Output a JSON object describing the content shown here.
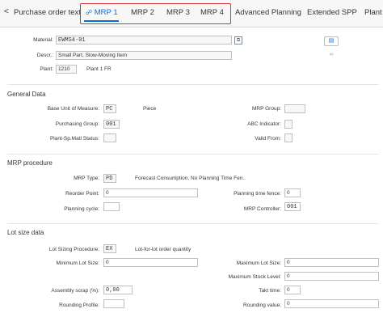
{
  "tabs": {
    "back_glyph": "<",
    "items": [
      {
        "label": "Purchase order text"
      },
      {
        "label": "MRP 1"
      },
      {
        "label": "MRP 2"
      },
      {
        "label": "MRP 3"
      },
      {
        "label": "MRP 4"
      },
      {
        "label": "Advanced Planning"
      },
      {
        "label": "Extended SPP"
      },
      {
        "label": "Plant"
      }
    ],
    "active_index": 1,
    "highlight_color": "#d9333a",
    "accent_color": "#0a6ed1"
  },
  "header": {
    "material_label": "Material:",
    "material_value": "EWMS4-01",
    "descr_label": "Descr.:",
    "descr_value": "Small Part, Slow-Moving Item",
    "plant_label": "Plant:",
    "plant_value": "1210",
    "plant_text": "Plant 1 FR"
  },
  "general": {
    "title": "General Data",
    "base_uom_label": "Base Unit of Measure:",
    "base_uom_value": "PC",
    "base_uom_text": "Piece",
    "purch_group_label": "Purchasing Group:",
    "purch_group_value": "001",
    "plant_sp_label": "Plant-Sp.Matl Status:",
    "plant_sp_value": "",
    "mrp_group_label": "MRP Group:",
    "mrp_group_value": "",
    "abc_label": "ABC Indicator:",
    "abc_value": "",
    "valid_from_label": "Valid From:",
    "valid_from_value": ""
  },
  "mrp": {
    "title": "MRP procedure",
    "mrp_type_label": "MRP Type:",
    "mrp_type_value": "PD",
    "mrp_type_text": "Forecast Consumption, No Planning Time Fen..",
    "reorder_label": "Reorder Point:",
    "reorder_value": "0",
    "planning_cycle_label": "Planning cycle:",
    "planning_cycle_value": "",
    "ptf_label": "Planning time fence:",
    "ptf_value": "0",
    "controller_label": "MRP Controller:",
    "controller_value": "001"
  },
  "lot": {
    "title": "Lot size data",
    "lsp_label": "Lot Sizing Procedure:",
    "lsp_value": "EX",
    "lsp_text": "Lot-for-lot order quantity",
    "min_label": "Minimum Lot Size:",
    "min_value": "0",
    "max_label": "Maximum Lot Size:",
    "max_value": "0",
    "max_stock_label": "Maximum Stock Level:",
    "max_stock_value": "0",
    "scrap_label": "Assembly scrap (%):",
    "scrap_value": "0,00",
    "takt_label": "Takt time:",
    "takt_value": "0",
    "rounding_profile_label": "Rounding Profile:",
    "rounding_profile_value": "",
    "rounding_value_label": "Rounding value:",
    "rounding_value_value": "0"
  },
  "icons": {
    "material_lookup": "copy-icon",
    "material_info": "info-icon",
    "glasses": "glasses-icon"
  }
}
